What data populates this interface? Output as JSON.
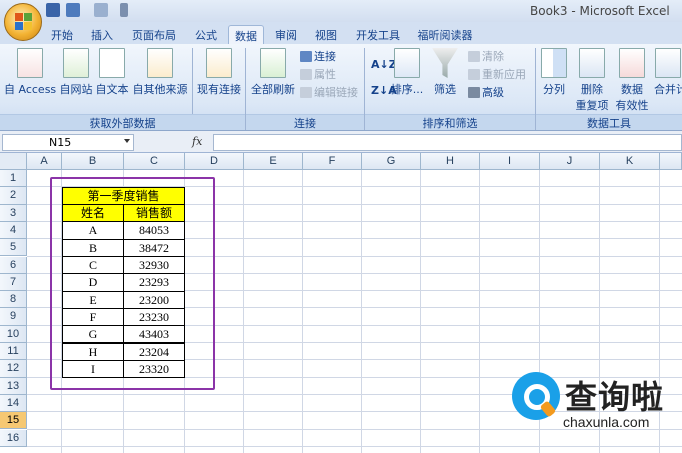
{
  "window": {
    "title": "Book3 - Microsoft Excel"
  },
  "tabs": [
    "开始",
    "插入",
    "页面布局",
    "公式",
    "数据",
    "审阅",
    "视图",
    "开发工具",
    "福昕阅读器"
  ],
  "active_tab": "数据",
  "ribbon": {
    "get_external": {
      "label": "获取外部数据",
      "items": [
        "自 Access",
        "自网站",
        "自文本",
        "自其他来源"
      ]
    },
    "existing_conn": "现有连接",
    "connections": {
      "label": "连接",
      "refresh_all": "全部刷新",
      "connect": "连接",
      "properties": "属性",
      "edit_links": "编辑链接"
    },
    "sort_filter": {
      "label": "排序和筛选",
      "sort": "排序...",
      "filter": "筛选",
      "clear": "清除",
      "reapply": "重新应用",
      "advanced": "高级"
    },
    "data_tools": {
      "label": "数据工具",
      "text_to_columns": "分列",
      "remove_dup_1": "删除",
      "remove_dup_2": "重复项",
      "validation_1": "数据",
      "validation_2": "有效性",
      "consolidate": "合并计"
    }
  },
  "formula_bar": {
    "name_box": "N15",
    "fx": "fx",
    "content": ""
  },
  "columns": [
    "A",
    "B",
    "C",
    "D",
    "E",
    "F",
    "G",
    "H",
    "I",
    "J",
    "K"
  ],
  "rows": [
    "1",
    "2",
    "3",
    "4",
    "5",
    "6",
    "7",
    "8",
    "9",
    "10",
    "11",
    "12",
    "13",
    "14",
    "15",
    "16"
  ],
  "selected_row": "15",
  "table": {
    "title": "第一季度销售",
    "headers": [
      "姓名",
      "销售额"
    ],
    "rows": [
      [
        "A",
        "84053"
      ],
      [
        "B",
        "38472"
      ],
      [
        "C",
        "32930"
      ],
      [
        "D",
        "23293"
      ],
      [
        "E",
        "23200"
      ],
      [
        "F",
        "23230"
      ],
      [
        "G",
        "43403"
      ],
      [
        "H",
        "23204"
      ],
      [
        "I",
        "23320"
      ]
    ]
  },
  "colors": {
    "header_fill": "#ffff00",
    "highlight_border": "#8b34a8"
  },
  "watermark": {
    "cn": "查询啦",
    "en": "chaxunla.com"
  }
}
